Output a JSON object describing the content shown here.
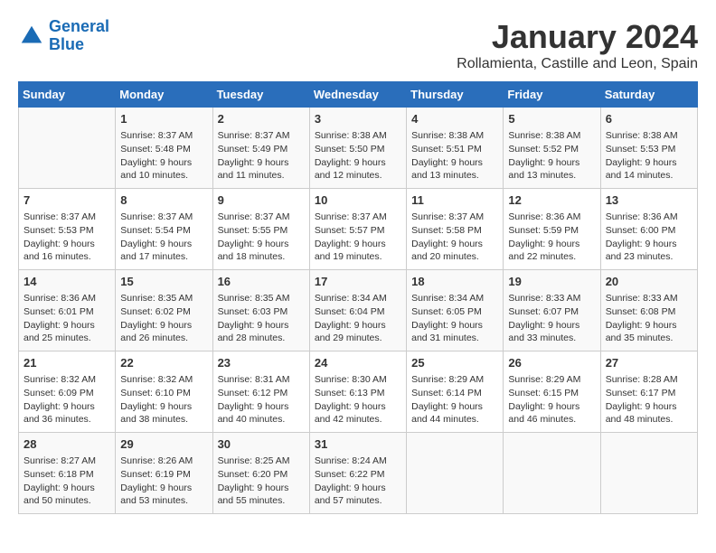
{
  "logo": {
    "line1": "General",
    "line2": "Blue"
  },
  "title": "January 2024",
  "subtitle": "Rollamienta, Castille and Leon, Spain",
  "headers": [
    "Sunday",
    "Monday",
    "Tuesday",
    "Wednesday",
    "Thursday",
    "Friday",
    "Saturday"
  ],
  "weeks": [
    [
      {
        "day": "",
        "info": ""
      },
      {
        "day": "1",
        "info": "Sunrise: 8:37 AM\nSunset: 5:48 PM\nDaylight: 9 hours\nand 10 minutes."
      },
      {
        "day": "2",
        "info": "Sunrise: 8:37 AM\nSunset: 5:49 PM\nDaylight: 9 hours\nand 11 minutes."
      },
      {
        "day": "3",
        "info": "Sunrise: 8:38 AM\nSunset: 5:50 PM\nDaylight: 9 hours\nand 12 minutes."
      },
      {
        "day": "4",
        "info": "Sunrise: 8:38 AM\nSunset: 5:51 PM\nDaylight: 9 hours\nand 13 minutes."
      },
      {
        "day": "5",
        "info": "Sunrise: 8:38 AM\nSunset: 5:52 PM\nDaylight: 9 hours\nand 13 minutes."
      },
      {
        "day": "6",
        "info": "Sunrise: 8:38 AM\nSunset: 5:53 PM\nDaylight: 9 hours\nand 14 minutes."
      }
    ],
    [
      {
        "day": "7",
        "info": "Sunrise: 8:37 AM\nSunset: 5:53 PM\nDaylight: 9 hours\nand 16 minutes."
      },
      {
        "day": "8",
        "info": "Sunrise: 8:37 AM\nSunset: 5:54 PM\nDaylight: 9 hours\nand 17 minutes."
      },
      {
        "day": "9",
        "info": "Sunrise: 8:37 AM\nSunset: 5:55 PM\nDaylight: 9 hours\nand 18 minutes."
      },
      {
        "day": "10",
        "info": "Sunrise: 8:37 AM\nSunset: 5:57 PM\nDaylight: 9 hours\nand 19 minutes."
      },
      {
        "day": "11",
        "info": "Sunrise: 8:37 AM\nSunset: 5:58 PM\nDaylight: 9 hours\nand 20 minutes."
      },
      {
        "day": "12",
        "info": "Sunrise: 8:36 AM\nSunset: 5:59 PM\nDaylight: 9 hours\nand 22 minutes."
      },
      {
        "day": "13",
        "info": "Sunrise: 8:36 AM\nSunset: 6:00 PM\nDaylight: 9 hours\nand 23 minutes."
      }
    ],
    [
      {
        "day": "14",
        "info": "Sunrise: 8:36 AM\nSunset: 6:01 PM\nDaylight: 9 hours\nand 25 minutes."
      },
      {
        "day": "15",
        "info": "Sunrise: 8:35 AM\nSunset: 6:02 PM\nDaylight: 9 hours\nand 26 minutes."
      },
      {
        "day": "16",
        "info": "Sunrise: 8:35 AM\nSunset: 6:03 PM\nDaylight: 9 hours\nand 28 minutes."
      },
      {
        "day": "17",
        "info": "Sunrise: 8:34 AM\nSunset: 6:04 PM\nDaylight: 9 hours\nand 29 minutes."
      },
      {
        "day": "18",
        "info": "Sunrise: 8:34 AM\nSunset: 6:05 PM\nDaylight: 9 hours\nand 31 minutes."
      },
      {
        "day": "19",
        "info": "Sunrise: 8:33 AM\nSunset: 6:07 PM\nDaylight: 9 hours\nand 33 minutes."
      },
      {
        "day": "20",
        "info": "Sunrise: 8:33 AM\nSunset: 6:08 PM\nDaylight: 9 hours\nand 35 minutes."
      }
    ],
    [
      {
        "day": "21",
        "info": "Sunrise: 8:32 AM\nSunset: 6:09 PM\nDaylight: 9 hours\nand 36 minutes."
      },
      {
        "day": "22",
        "info": "Sunrise: 8:32 AM\nSunset: 6:10 PM\nDaylight: 9 hours\nand 38 minutes."
      },
      {
        "day": "23",
        "info": "Sunrise: 8:31 AM\nSunset: 6:12 PM\nDaylight: 9 hours\nand 40 minutes."
      },
      {
        "day": "24",
        "info": "Sunrise: 8:30 AM\nSunset: 6:13 PM\nDaylight: 9 hours\nand 42 minutes."
      },
      {
        "day": "25",
        "info": "Sunrise: 8:29 AM\nSunset: 6:14 PM\nDaylight: 9 hours\nand 44 minutes."
      },
      {
        "day": "26",
        "info": "Sunrise: 8:29 AM\nSunset: 6:15 PM\nDaylight: 9 hours\nand 46 minutes."
      },
      {
        "day": "27",
        "info": "Sunrise: 8:28 AM\nSunset: 6:17 PM\nDaylight: 9 hours\nand 48 minutes."
      }
    ],
    [
      {
        "day": "28",
        "info": "Sunrise: 8:27 AM\nSunset: 6:18 PM\nDaylight: 9 hours\nand 50 minutes."
      },
      {
        "day": "29",
        "info": "Sunrise: 8:26 AM\nSunset: 6:19 PM\nDaylight: 9 hours\nand 53 minutes."
      },
      {
        "day": "30",
        "info": "Sunrise: 8:25 AM\nSunset: 6:20 PM\nDaylight: 9 hours\nand 55 minutes."
      },
      {
        "day": "31",
        "info": "Sunrise: 8:24 AM\nSunset: 6:22 PM\nDaylight: 9 hours\nand 57 minutes."
      },
      {
        "day": "",
        "info": ""
      },
      {
        "day": "",
        "info": ""
      },
      {
        "day": "",
        "info": ""
      }
    ]
  ]
}
